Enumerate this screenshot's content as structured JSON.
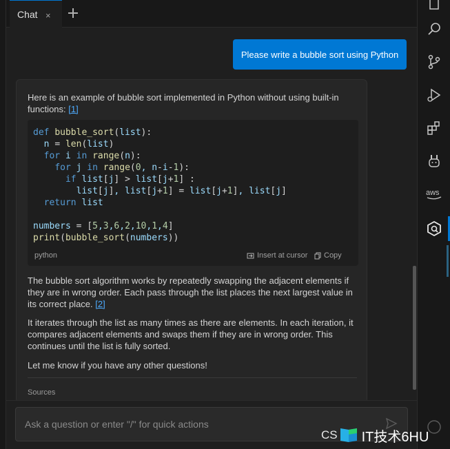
{
  "tabs": {
    "active_label": "Chat",
    "close_icon": "×"
  },
  "user_message": "Please write a bubble sort using Python",
  "bot": {
    "intro": "Here is an example of bubble sort implemented in Python without using built-in functions:",
    "intro_ref": "[1]",
    "code_language": "python",
    "insert_label": "Insert at cursor",
    "copy_label": "Copy",
    "para1": "The bubble sort algorithm works by repeatedly swapping the adjacent elements if they are in wrong order. Each pass through the list places the next largest value in its correct place.",
    "para1_ref": "[2]",
    "para2": "It iterates through the list as many times as there are elements. In each iteration, it compares adjacent elements and swaps them if they are in wrong order. This continues until the list is fully sorted.",
    "para3": "Let me know if you have any other questions!",
    "sources_label": "Sources"
  },
  "input": {
    "placeholder": "Ask a question or enter \"/\" for quick actions"
  },
  "watermark": {
    "prefix": "CS",
    "text": "IT技术6HU"
  },
  "colors": {
    "accent": "#0078d4",
    "link": "#4daafc"
  }
}
